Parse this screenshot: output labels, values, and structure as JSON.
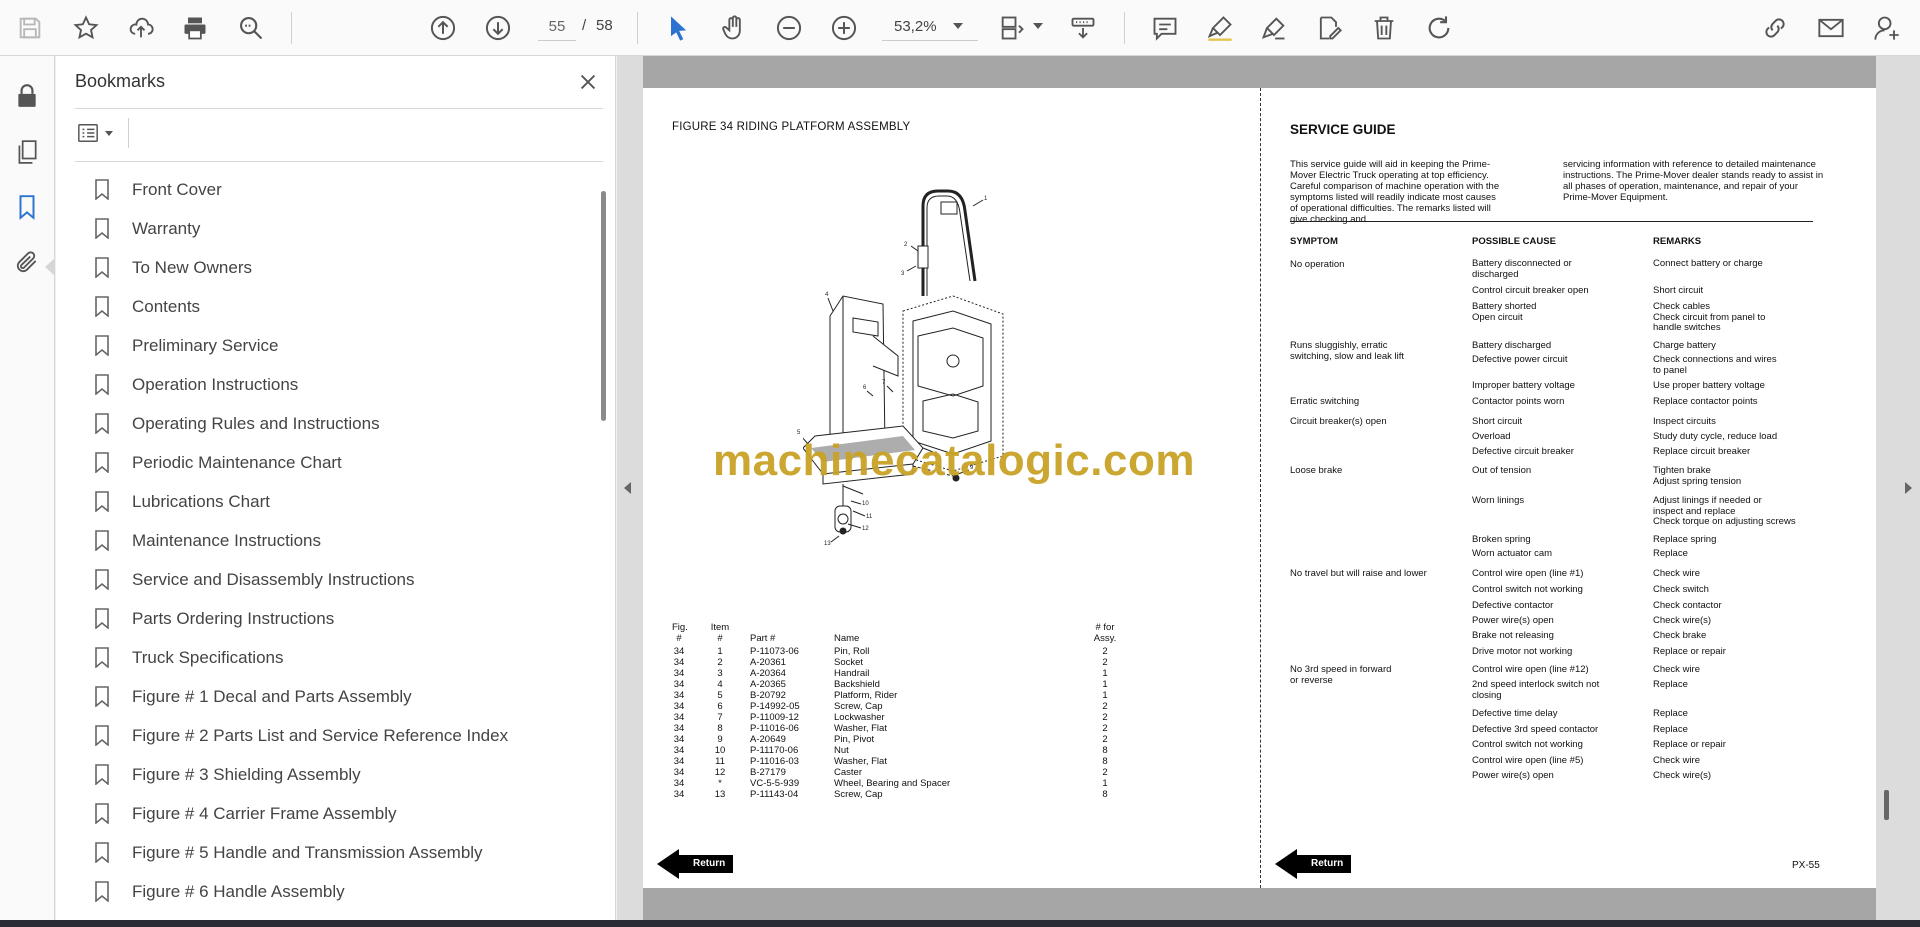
{
  "toolbar": {
    "current_page": "55",
    "page_separator": "/",
    "total_pages": "58",
    "zoom": "53,2%"
  },
  "bookmarks": {
    "title": "Bookmarks",
    "items": [
      "Front Cover",
      "Warranty",
      "To New Owners",
      "Contents",
      "Preliminary Service",
      "Operation Instructions",
      "Operating Rules and Instructions",
      "Periodic Maintenance Chart",
      "Lubrications Chart",
      "Maintenance Instructions",
      "Service and Disassembly Instructions",
      "Parts Ordering Instructions",
      "Truck Specifications",
      "Figure # 1 Decal and Parts Assembly",
      "Figure # 2 Parts List and Service Reference Index",
      "Figure # 3 Shielding Assembly",
      "Figure # 4 Carrier Frame Assembly",
      "Figure # 5 Handle and Transmission Assembly",
      "Figure # 6 Handle Assembly"
    ]
  },
  "document": {
    "figure_title": "FIGURE 34  RIDING PLATFORM ASSEMBLY",
    "parts_header": {
      "fig": "Fig.\n#",
      "item": "Item\n#",
      "part": "Part #",
      "name": "Name",
      "assy": "# for\nAssy."
    },
    "parts_rows": [
      {
        "fig": "34",
        "item": "1",
        "part": "P-11073-06",
        "name": "Pin, Roll",
        "qty": "2"
      },
      {
        "fig": "34",
        "item": "2",
        "part": "A-20361",
        "name": "Socket",
        "qty": "2"
      },
      {
        "fig": "34",
        "item": "3",
        "part": "A-20364",
        "name": "Handrail",
        "qty": "1"
      },
      {
        "fig": "34",
        "item": "4",
        "part": "A-20365",
        "name": "Backshield",
        "qty": "1"
      },
      {
        "fig": "34",
        "item": "5",
        "part": "B-20792",
        "name": "Platform, Rider",
        "qty": "1"
      },
      {
        "fig": "34",
        "item": "6",
        "part": "P-14992-05",
        "name": "Screw, Cap",
        "qty": "2"
      },
      {
        "fig": "34",
        "item": "7",
        "part": "P-11009-12",
        "name": "Lockwasher",
        "qty": "2"
      },
      {
        "fig": "34",
        "item": "8",
        "part": "P-11016-06",
        "name": "Washer, Flat",
        "qty": "2"
      },
      {
        "fig": "34",
        "item": "9",
        "part": "A-20649",
        "name": "Pin, Pivot",
        "qty": "2"
      },
      {
        "fig": "34",
        "item": "10",
        "part": "P-11170-06",
        "name": "Nut",
        "qty": "8"
      },
      {
        "fig": "34",
        "item": "11",
        "part": "P-11016-03",
        "name": "Washer, Flat",
        "qty": "8"
      },
      {
        "fig": "34",
        "item": "12",
        "part": "B-27179",
        "name": "Caster",
        "qty": "2"
      },
      {
        "fig": "34",
        "item": "*",
        "part": "VC-5-5-939",
        "name": "Wheel, Bearing and Spacer",
        "qty": "1"
      },
      {
        "fig": "34",
        "item": "13",
        "part": "P-11143-04",
        "name": "Screw, Cap",
        "qty": "8"
      }
    ],
    "return_label": "Return",
    "service_guide": {
      "title": "SERVICE GUIDE",
      "intro_left": "This service guide will aid in keeping the Prime-Mover Electric Truck operating at top efficiency. Careful comparison of machine operation with the symptoms listed will readily indicate most causes of operational difficulties. The remarks listed will give checking and",
      "intro_right": "servicing information with reference to detailed maintenance instructions. The Prime-Mover dealer stands ready to assist in all phases of operation, maintenance, and repair of your Prime-Mover Equipment.",
      "col_symptom": "SYMPTOM",
      "col_cause": "POSSIBLE CAUSE",
      "col_remarks": "REMARKS",
      "symptoms": [
        "No operation",
        "Runs sluggishly, erratic\nswitching, slow and leak lift",
        "Erratic switching",
        "Circuit breaker(s) open",
        "Loose brake",
        "No travel but will raise and lower",
        "No 3rd speed in forward\nor reverse"
      ],
      "rows": [
        {
          "cause": "Battery disconnected or\ndischarged",
          "remark": "Connect battery or charge"
        },
        {
          "cause": "Control circuit breaker open",
          "remark": "Short circuit"
        },
        {
          "cause": "Battery shorted\nOpen circuit",
          "remark": "Check cables\nCheck circuit from panel to\nhandle switches"
        },
        {
          "cause": "Battery discharged",
          "remark": "Charge battery"
        },
        {
          "cause": "Defective power circuit",
          "remark": "Check connections and wires\nto panel"
        },
        {
          "cause": "Improper battery voltage",
          "remark": "Use proper battery voltage"
        },
        {
          "cause": "Contactor points worn",
          "remark": "Replace contactor points"
        },
        {
          "cause": "Short circuit",
          "remark": "Inspect circuits"
        },
        {
          "cause": "Overload",
          "remark": "Study duty cycle, reduce load"
        },
        {
          "cause": "Defective circuit breaker",
          "remark": "Replace circuit breaker"
        },
        {
          "cause": "Out of tension",
          "remark": "Tighten brake\nAdjust spring tension"
        },
        {
          "cause": "Worn linings",
          "remark": "Adjust linings if needed or\ninspect and replace\nCheck torque on adjusting screws"
        },
        {
          "cause": "Broken spring",
          "remark": "Replace spring"
        },
        {
          "cause": "Worn actuator cam",
          "remark": "Replace"
        },
        {
          "cause": "Control wire open (line #1)",
          "remark": "Check wire"
        },
        {
          "cause": "Control switch not working",
          "remark": "Check switch"
        },
        {
          "cause": "Defective contactor",
          "remark": "Check contactor"
        },
        {
          "cause": "Power wire(s) open",
          "remark": "Check wire(s)"
        },
        {
          "cause": "Brake not releasing",
          "remark": "Check brake"
        },
        {
          "cause": "Drive motor not working",
          "remark": "Replace or repair"
        },
        {
          "cause": "Control wire open (line #12)",
          "remark": "Check wire"
        },
        {
          "cause": "2nd speed interlock switch not\nclosing",
          "remark": "Replace"
        },
        {
          "cause": "Defective time delay",
          "remark": "Replace"
        },
        {
          "cause": "Defective 3rd speed contactor",
          "remark": "Replace"
        },
        {
          "cause": "Control switch not working",
          "remark": "Replace or repair"
        },
        {
          "cause": "Control wire open (line #5)",
          "remark": "Check wire"
        },
        {
          "cause": "Power wire(s) open",
          "remark": "Check wire(s)"
        }
      ]
    },
    "page_number": "PX-55",
    "callouts": [
      "1",
      "2",
      "3",
      "4",
      "5",
      "6",
      "7",
      "8",
      "9",
      "10",
      "11",
      "12",
      "13"
    ]
  },
  "watermark": "machinecatalogic.com",
  "colors": {
    "accent_blue": "#2a73d0",
    "watermark": "#c9a227",
    "page_band": "#a6a6a6"
  },
  "icons": [
    "save-icon",
    "star-icon",
    "upload-icon",
    "print-icon",
    "zoom-search-icon",
    "page-up-icon",
    "page-down-icon",
    "cursor-icon",
    "hand-icon",
    "zoom-out-icon",
    "zoom-in-icon",
    "page-fit-icon",
    "scroll-mode-icon",
    "comment-icon",
    "highlight-icon",
    "sign-icon",
    "edit-pdf-icon",
    "delete-icon",
    "rotate-icon",
    "link-icon",
    "mail-icon",
    "user-add-icon",
    "lock-icon",
    "pages-icon",
    "bookmark-icon",
    "attachment-icon"
  ]
}
